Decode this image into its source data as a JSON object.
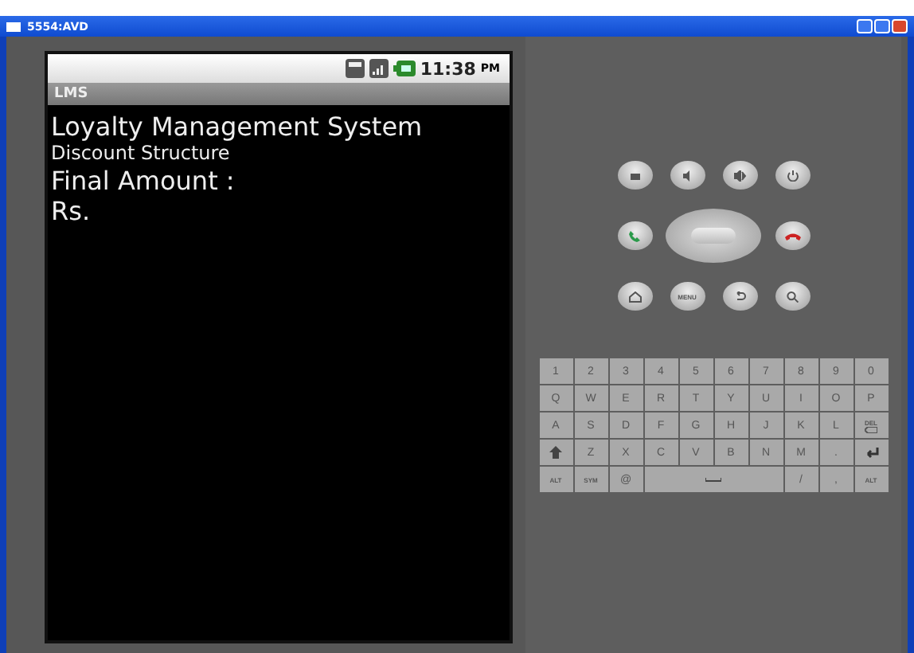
{
  "window": {
    "title": "5554:AVD"
  },
  "status_bar": {
    "time": "11:38",
    "meridiem": "PM"
  },
  "app": {
    "title": "LMS",
    "lines": [
      {
        "text": "Loyalty Management System",
        "kind": "large"
      },
      {
        "text": "Discount Structure",
        "kind": "small"
      },
      {
        "text": "Final Amount :",
        "kind": "large"
      },
      {
        "text": "Rs.",
        "kind": "large"
      }
    ]
  },
  "controls": {
    "menu_label": "MENU"
  },
  "keyboard": {
    "rows": [
      [
        {
          "label": "1"
        },
        {
          "label": "2"
        },
        {
          "label": "3"
        },
        {
          "label": "4"
        },
        {
          "label": "5"
        },
        {
          "label": "6"
        },
        {
          "label": "7"
        },
        {
          "label": "8"
        },
        {
          "label": "9"
        },
        {
          "label": "0"
        }
      ],
      [
        {
          "label": "Q"
        },
        {
          "label": "W"
        },
        {
          "label": "E"
        },
        {
          "label": "R"
        },
        {
          "label": "T"
        },
        {
          "label": "Y"
        },
        {
          "label": "U"
        },
        {
          "label": "I"
        },
        {
          "label": "O"
        },
        {
          "label": "P"
        }
      ],
      [
        {
          "label": "A"
        },
        {
          "label": "S"
        },
        {
          "label": "D"
        },
        {
          "label": "F"
        },
        {
          "label": "G"
        },
        {
          "label": "H"
        },
        {
          "label": "J"
        },
        {
          "label": "K"
        },
        {
          "label": "L"
        },
        {
          "label": "DEL",
          "kind": "del"
        }
      ],
      [
        {
          "kind": "shift"
        },
        {
          "label": "Z"
        },
        {
          "label": "X"
        },
        {
          "label": "C"
        },
        {
          "label": "V"
        },
        {
          "label": "B"
        },
        {
          "label": "N"
        },
        {
          "label": "M"
        },
        {
          "label": "."
        },
        {
          "kind": "enter"
        }
      ]
    ],
    "bottom_left": [
      {
        "label": "ALT",
        "kind": "small"
      },
      {
        "label": "SYM",
        "kind": "small"
      },
      {
        "label": "@"
      }
    ],
    "bottom_right": [
      {
        "label": "/"
      },
      {
        "label": ","
      },
      {
        "label": "ALT",
        "kind": "small"
      }
    ]
  }
}
